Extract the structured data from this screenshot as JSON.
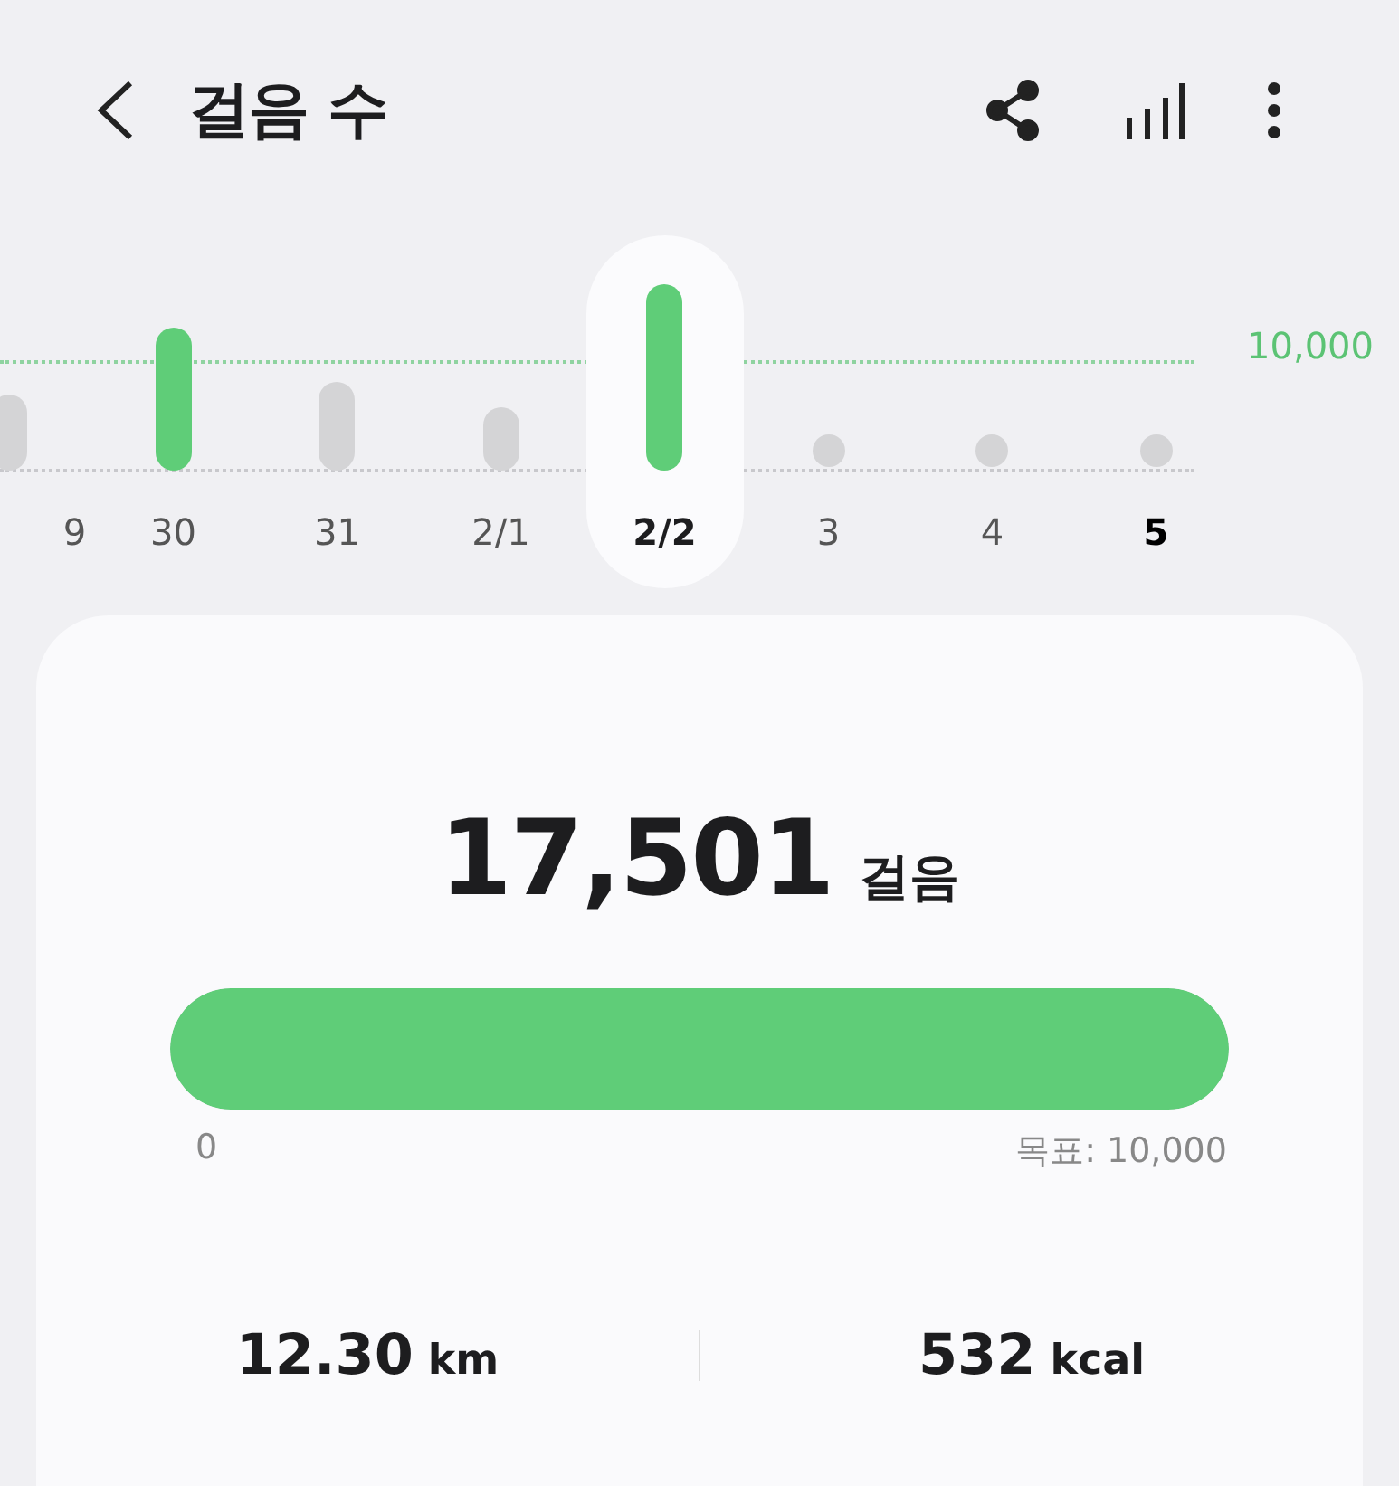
{
  "header": {
    "title": "걸음 수"
  },
  "chart": {
    "goal_label": "10,000",
    "days": [
      {
        "label": "9",
        "kind": "bar",
        "goal_met": false,
        "selected": false,
        "today": false
      },
      {
        "label": "30",
        "kind": "bar",
        "goal_met": true,
        "selected": false,
        "today": false
      },
      {
        "label": "31",
        "kind": "bar",
        "goal_met": false,
        "selected": false,
        "today": false
      },
      {
        "label": "2/1",
        "kind": "bar",
        "goal_met": false,
        "selected": false,
        "today": false
      },
      {
        "label": "2/2",
        "kind": "bar",
        "goal_met": true,
        "selected": true,
        "today": false
      },
      {
        "label": "3",
        "kind": "dot",
        "goal_met": false,
        "selected": false,
        "today": false
      },
      {
        "label": "4",
        "kind": "dot",
        "goal_met": false,
        "selected": false,
        "today": false
      },
      {
        "label": "5",
        "kind": "dot",
        "goal_met": false,
        "selected": false,
        "today": true
      }
    ]
  },
  "summary": {
    "steps": "17,501",
    "steps_unit": "걸음",
    "progress": {
      "level": 1,
      "min_label": "0",
      "goal_label": "목표: 10,000"
    },
    "stats": [
      {
        "value": "12.30",
        "unit": "km"
      },
      {
        "value": "532",
        "unit": "kcal"
      }
    ]
  }
}
